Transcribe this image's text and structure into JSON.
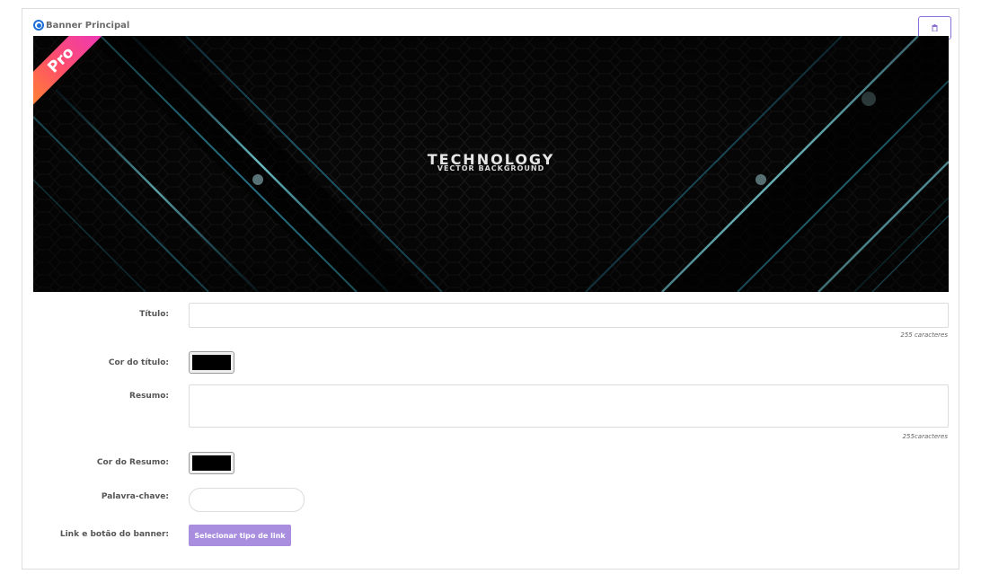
{
  "banner_section": {
    "radio_label": "Banner Principal",
    "delete_icon": "trash-icon",
    "accent_color": "#8b6fd6"
  },
  "banner_image": {
    "title": "TECHNOLOGY",
    "subtitle": "VECTOR BACKGROUND",
    "ribbon": "Pro"
  },
  "form": {
    "titulo_label": "Título:",
    "titulo_value": "",
    "titulo_hint": "255 caracteres",
    "cor_titulo_label": "Cor do título:",
    "cor_titulo_value": "#000000",
    "resumo_label": "Resumo:",
    "resumo_value": "",
    "resumo_hint": "255caracteres",
    "cor_resumo_label": "Cor do Resumo:",
    "cor_resumo_value": "#000000",
    "palavra_label": "Palavra-chave:",
    "palavra_value": "",
    "link_label": "Link e botão do banner:",
    "link_button": "Selecionar tipo de link",
    "link_button_color": "#a98ee0"
  }
}
